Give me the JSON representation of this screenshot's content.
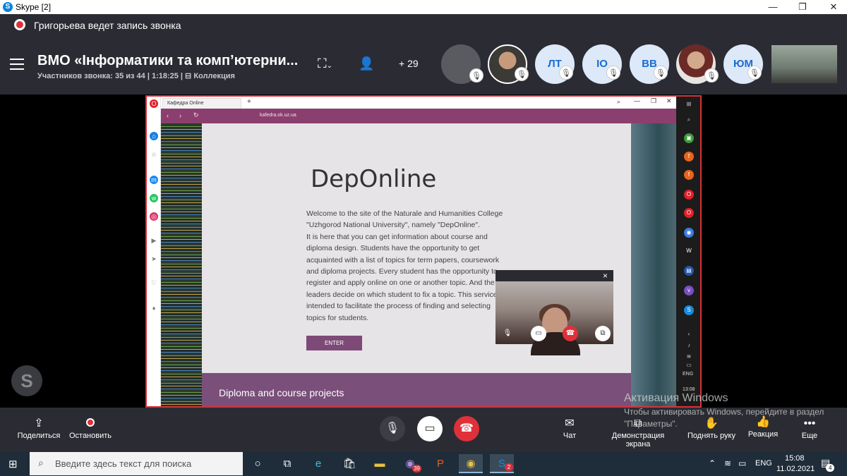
{
  "window": {
    "title": "Skype [2]",
    "minimize": "—",
    "maximize": "❐",
    "close": "✕"
  },
  "recording": {
    "text": "Григорьева ведет запись звонка"
  },
  "call": {
    "title": "ВМО «Інформатики та комп’ютерни...",
    "subtitle": "Участников звонка: 35 из 44 | 1:18:25 | ⊟ Коллекция",
    "more_participants": "+ 29",
    "participants": [
      {
        "kind": "gray"
      },
      {
        "kind": "photo1"
      },
      {
        "kind": "initials",
        "text": "ЛТ"
      },
      {
        "kind": "initials",
        "text": "ІО"
      },
      {
        "kind": "initials",
        "text": "ВВ"
      },
      {
        "kind": "photo2"
      },
      {
        "kind": "initials",
        "text": "ЮМ"
      }
    ]
  },
  "browser": {
    "tab_label": "Кафедра Online",
    "url": "kafedra.ok.uz.ua",
    "page_title": "DepOnline",
    "page_text": "Welcome to the site of the Naturale and Humanities College \"Uzhgorod National University\", namely \"DepOnline\".\nIt is here that you can get information about course and diploma design. Students have the opportunity to get acquainted with a list of topics for term papers, coursework and diploma projects. Every student has the opportunity to register and apply online on one or another topic. And the leaders decide on which student to fix a topic. This service intended to facilitate the process of finding and selecting topics for students.",
    "enter_label": "ENTER",
    "band_label": "Diploma and course projects",
    "side_tray": {
      "lang": "ENG",
      "time": "13:08"
    }
  },
  "pip": {
    "close": "×"
  },
  "controls": {
    "share": "Поделиться",
    "stop": "Остановить",
    "chat": "Чат",
    "screen": "Демонстрация экрана",
    "hand": "Поднять руку",
    "react": "Реакция",
    "more": "Еще"
  },
  "watermark": {
    "line1": "Активация Windows",
    "line2": "Чтобы активировать Windows, перейдите в раздел \"Параметры\"."
  },
  "taskbar": {
    "search_placeholder": "Введите здесь текст для поиска",
    "viber_badge": "39",
    "skype_badge": "2",
    "lang": "ENG",
    "time": "15:08",
    "date": "11.02.2021",
    "notif_count": "4"
  }
}
